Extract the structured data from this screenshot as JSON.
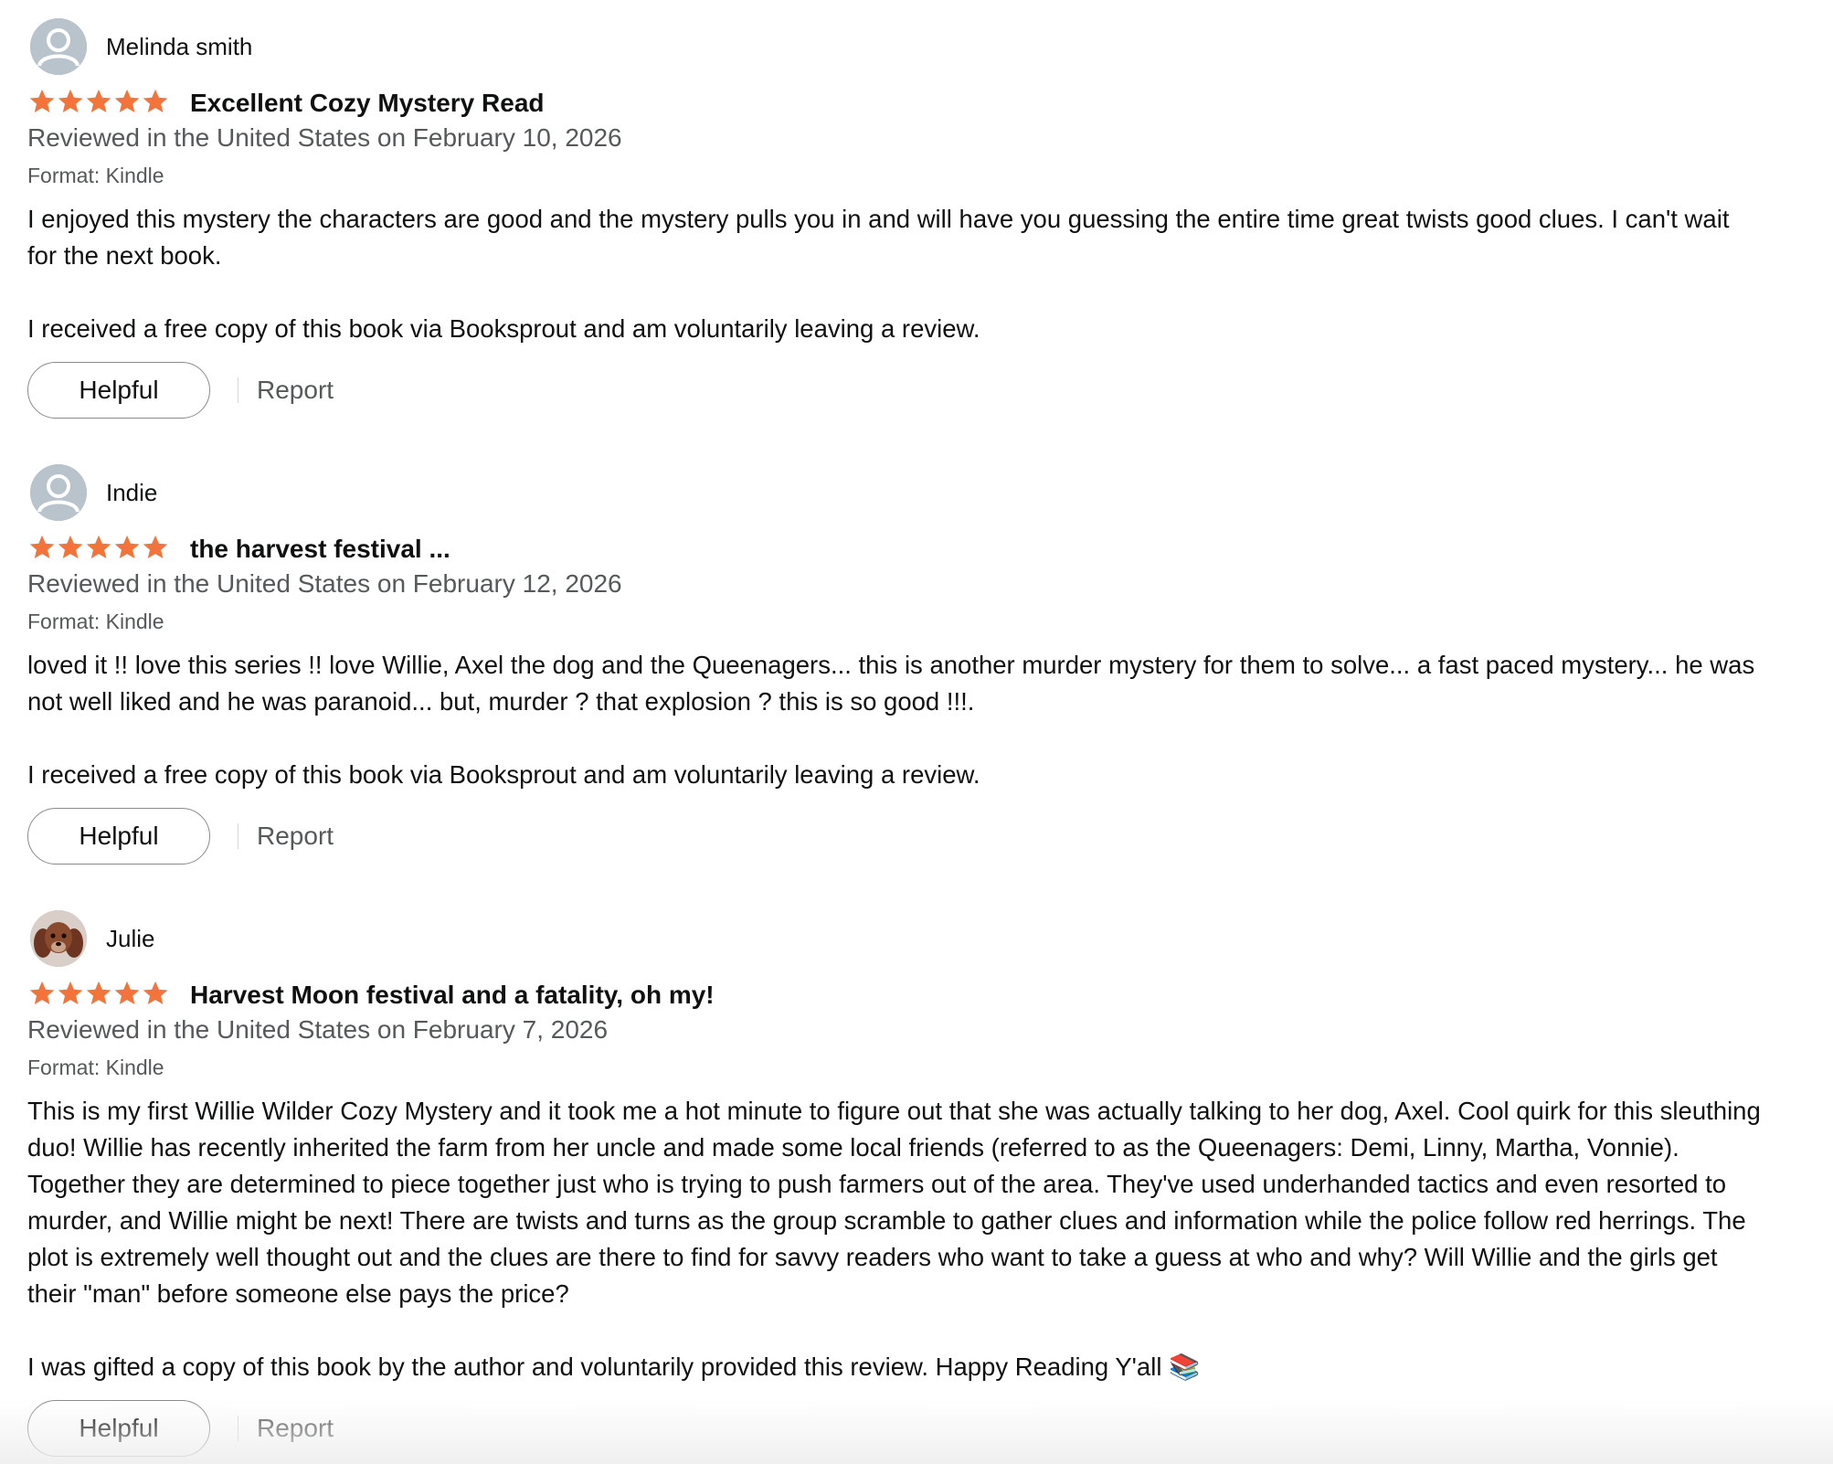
{
  "colors": {
    "star": "#f3743a",
    "muted": "#565959",
    "text": "#0f1111"
  },
  "reviews": [
    {
      "reviewer": "Melinda smith",
      "avatar_icon": "default-user-icon",
      "rating": 5,
      "title": "Excellent Cozy Mystery Read",
      "date": "Reviewed in the United States on February 10, 2026",
      "format": "Format: Kindle",
      "body": [
        "I enjoyed this mystery the characters are good and the mystery pulls you in and will have you guessing the entire time great twists good clues. I can't wait for the next book.",
        "I received a free copy of this book via Booksprout and am voluntarily leaving a review."
      ],
      "helpful_label": "Helpful",
      "report_label": "Report"
    },
    {
      "reviewer": "Indie",
      "avatar_icon": "default-user-icon",
      "rating": 5,
      "title": "the harvest festival ...",
      "date": "Reviewed in the United States on February 12, 2026",
      "format": "Format: Kindle",
      "body": [
        "loved it !! love this series !! love Willie, Axel the dog and the Queenagers... this is another murder mystery for them to solve... a fast paced mystery... he was not well liked and he was paranoid... but, murder ? that explosion ? this is so good !!!.",
        "I received a free copy of this book via Booksprout and am voluntarily leaving a review."
      ],
      "helpful_label": "Helpful",
      "report_label": "Report"
    },
    {
      "reviewer": "Julie",
      "avatar_icon": "dog-photo-avatar",
      "rating": 5,
      "title": "Harvest Moon festival and a fatality, oh my!",
      "date": "Reviewed in the United States on February 7, 2026",
      "format": "Format: Kindle",
      "body": [
        "This is my first Willie Wilder Cozy Mystery and it took me a hot minute to figure out that she was actually talking to her dog, Axel. Cool quirk for this sleuthing duo! Willie has recently inherited the farm from her uncle and made some local friends (referred to as the Queenagers: Demi, Linny, Martha, Vonnie). Together they are determined to piece together just who is trying to push farmers out of the area. They've used underhanded tactics and even resorted to murder, and Willie might be next! There are twists and turns as the group scramble to gather clues and information while the police follow red herrings. The plot is extremely well thought out and the clues are there to find for savvy readers who want to take a guess at who and why? Will Willie and the girls get their \"man\" before someone else pays the price?",
        "I was gifted a copy of this book by the author and voluntarily provided this review. Happy Reading Y'all 📚"
      ],
      "helpful_label": "Helpful",
      "report_label": "Report"
    }
  ]
}
